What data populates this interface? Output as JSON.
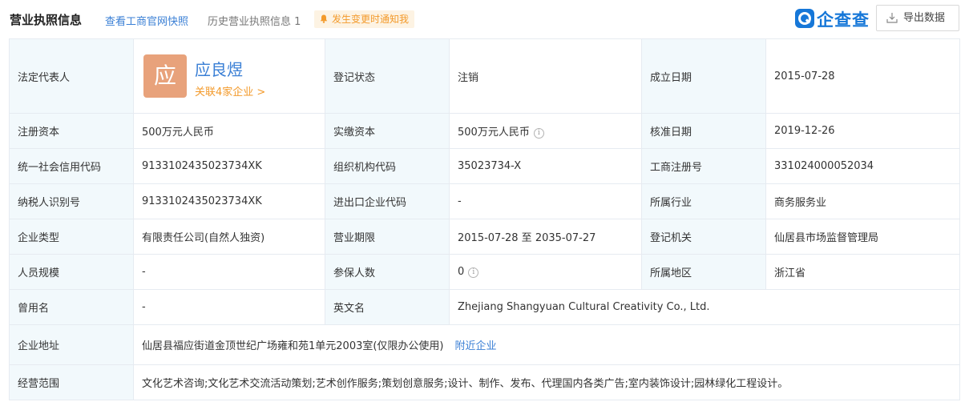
{
  "header": {
    "title": "营业执照信息",
    "quick_link": "查看工商官网快照",
    "history_link": "历史营业执照信息 1",
    "notify_label": "发生变更时通知我",
    "logo_text": "企查查",
    "export_label": "导出数据"
  },
  "colors": {
    "accent": "#3a7fd5",
    "orange": "#f39a2b",
    "label_bg": "#f2f9fc",
    "avatar": "#e8a27b",
    "brand": "#1677d8"
  },
  "rows": {
    "legal_rep": {
      "label": "法定代表人",
      "avatar_char": "应",
      "name": "应良煜",
      "related": "关联4家企业 >"
    },
    "reg_status": {
      "label": "登记状态",
      "value": "注销"
    },
    "est_date": {
      "label": "成立日期",
      "value": "2015-07-28"
    },
    "reg_capital": {
      "label": "注册资本",
      "value": "500万元人民币"
    },
    "paid_capital": {
      "label": "实缴资本",
      "value": "500万元人民币"
    },
    "approval_date": {
      "label": "核准日期",
      "value": "2019-12-26"
    },
    "credit_code": {
      "label": "统一社会信用代码",
      "value": "913310243502373​4XK"
    },
    "org_code": {
      "label": "组织机构代码",
      "value": "35023734-X"
    },
    "biz_reg_no": {
      "label": "工商注册号",
      "value": "331024000052034"
    },
    "taxpayer_id": {
      "label": "纳税人识别号",
      "value": "91331024350237​34XK"
    },
    "import_export": {
      "label": "进出口企业代码",
      "value": "-"
    },
    "industry": {
      "label": "所属行业",
      "value": "商务服务业"
    },
    "company_type": {
      "label": "企业类型",
      "value": "有限责任公司(自然人独资)"
    },
    "biz_term": {
      "label": "营业期限",
      "value": "2015-07-28 至 2035-07-27"
    },
    "reg_authority": {
      "label": "登记机关",
      "value": "仙居县市场监督管理局"
    },
    "staff_size": {
      "label": "人员规模",
      "value": "-"
    },
    "insured": {
      "label": "参保人数",
      "value": "0"
    },
    "region": {
      "label": "所属地区",
      "value": "浙江省"
    },
    "former_name": {
      "label": "曾用名",
      "value": "-"
    },
    "english_name": {
      "label": "英文名",
      "value": "Zhejiang Shangyuan Cultural Creativity Co., Ltd."
    },
    "address": {
      "label": "企业地址",
      "value": "仙居县福应街道金顶世纪广场雍和苑1单元2003室(仅限办公使用)",
      "nearby": "附近企业"
    },
    "scope": {
      "label": "经营范围",
      "value": "文化艺术咨询;文化艺术交流活动策划;艺术创作服务;策划创意服务;设计、制作、发布、代理国内各类广告;室内装饰设计;园林绿化工程设计。"
    }
  }
}
